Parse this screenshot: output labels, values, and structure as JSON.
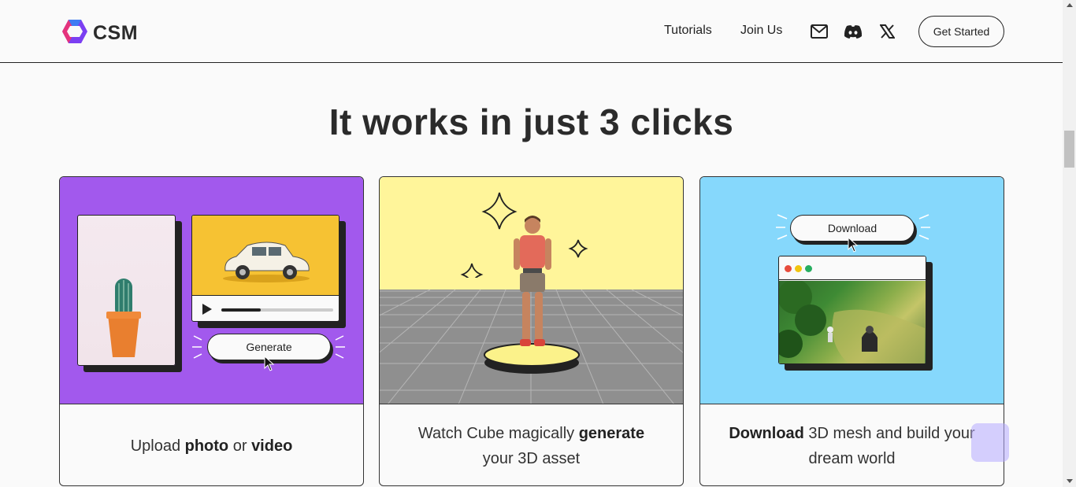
{
  "header": {
    "logo_text": "CSM",
    "nav": {
      "tutorials": "Tutorials",
      "join_us": "Join Us"
    },
    "icons": [
      "mail-icon",
      "discord-icon",
      "x-icon"
    ],
    "cta": "Get Started"
  },
  "section": {
    "title": "It works in just 3 clicks"
  },
  "cards": [
    {
      "bg": "#a259ed",
      "generate_label": "Generate",
      "progress": 0.35,
      "caption": {
        "t1": "Upload ",
        "b1": "photo",
        "t2": " or ",
        "b2": "video"
      }
    },
    {
      "bg": "#fff59a",
      "caption": {
        "t1": "Watch Cube magically ",
        "b1": "generate",
        "t2": " your 3D asset"
      }
    },
    {
      "bg": "#86d8fc",
      "download_label": "Download",
      "caption": {
        "b1": "Download",
        "t1": " 3D mesh and build your dream world"
      }
    }
  ],
  "colors": {
    "brand_pink": "#e5337c",
    "brand_purple": "#7b3ff2",
    "brand_blue": "#3f7bf2",
    "dot_red": "#e74c3c",
    "dot_yellow": "#f1c40f",
    "dot_green": "#27ae60"
  }
}
